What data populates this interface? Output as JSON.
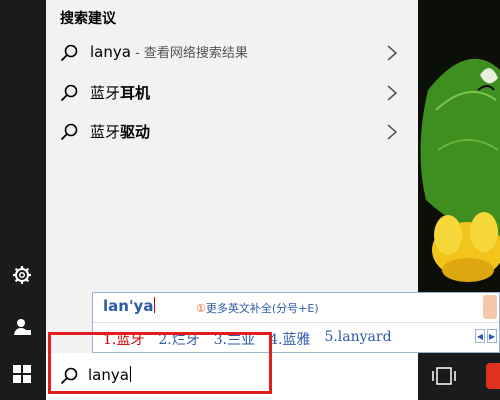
{
  "search_panel": {
    "title": "搜索建议",
    "suggestions": [
      {
        "query": "lanya",
        "hint": " - 查看网络搜索结果",
        "bold": ""
      },
      {
        "query": "蓝牙",
        "hint": "",
        "bold": "耳机"
      },
      {
        "query": "蓝牙",
        "hint": "",
        "bold": "驱动"
      }
    ]
  },
  "ime": {
    "composition": "lan'ya",
    "more_marker": "①",
    "more_label": "更多英文补全(分号+E)",
    "candidates": [
      {
        "label": "1.蓝牙"
      },
      {
        "label": "2.烂牙"
      },
      {
        "label": "3.兰亚"
      },
      {
        "label": "4.蓝雅"
      },
      {
        "label": "5.lanyard"
      }
    ],
    "prev_label": "◀",
    "next_label": "▶"
  },
  "taskbar": {
    "search_value": "lanya"
  },
  "icons": {
    "rail": [
      "gear-icon",
      "user-icon",
      "windows-icon"
    ],
    "search": "search-icon",
    "chevron": "chevron-right-icon",
    "taskview": "task-view-icon"
  },
  "colors": {
    "highlight": "#e11d1d",
    "ime_text": "#2e5aa8",
    "ime_first_candidate": "#d40000"
  }
}
